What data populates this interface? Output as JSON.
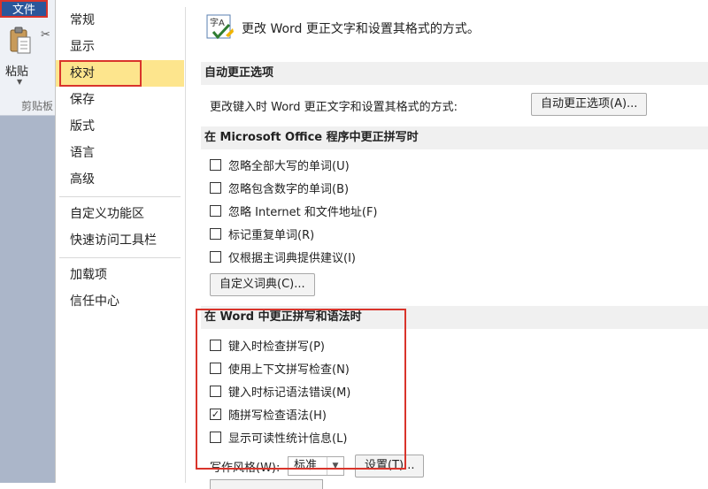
{
  "ribbon": {
    "file_tab": "文件",
    "paste_label": "粘贴",
    "paste_arrow": "▼",
    "group_label": "剪贴板"
  },
  "nav": {
    "items": [
      {
        "label": "常规"
      },
      {
        "label": "显示"
      },
      {
        "label": "校对",
        "active": true
      },
      {
        "label": "保存"
      },
      {
        "label": "版式"
      },
      {
        "label": "语言"
      },
      {
        "label": "高级"
      },
      {
        "label": "自定义功能区"
      },
      {
        "label": "快速访问工具栏"
      },
      {
        "label": "加载项"
      },
      {
        "label": "信任中心"
      }
    ]
  },
  "intro": {
    "icon_text": "字A",
    "text": "更改 Word 更正文字和设置其格式的方式。"
  },
  "autocorrect": {
    "heading": "自动更正选项",
    "label": "更改键入时 Word 更正文字和设置其格式的方式:",
    "button": "自动更正选项(A)..."
  },
  "office_spelling": {
    "heading": "在 Microsoft Office 程序中更正拼写时",
    "options": [
      {
        "label": "忽略全部大写的单词(U)",
        "checked": false
      },
      {
        "label": "忽略包含数字的单词(B)",
        "checked": false
      },
      {
        "label": "忽略 Internet 和文件地址(F)",
        "checked": false
      },
      {
        "label": "标记重复单词(R)",
        "checked": false
      },
      {
        "label": "仅根据主词典提供建议(I)",
        "checked": false
      }
    ],
    "dict_button": "自定义词典(C)..."
  },
  "word_spelling": {
    "heading": "在 Word 中更正拼写和语法时",
    "options": [
      {
        "label": "键入时检查拼写(P)",
        "checked": false
      },
      {
        "label": "使用上下文拼写检查(N)",
        "checked": false
      },
      {
        "label": "键入时标记语法错误(M)",
        "checked": false
      },
      {
        "label": "随拼写检查语法(H)",
        "checked": true
      },
      {
        "label": "显示可读性统计信息(L)",
        "checked": false
      }
    ],
    "style_label": "写作风格(W):",
    "style_value": "标准",
    "settings_button": "设置(T)..."
  },
  "colors": {
    "file_tab": "#2b579a",
    "highlight": "#d9342b",
    "nav_active": "#fde58d",
    "section_bg": "#f0f0f0"
  }
}
